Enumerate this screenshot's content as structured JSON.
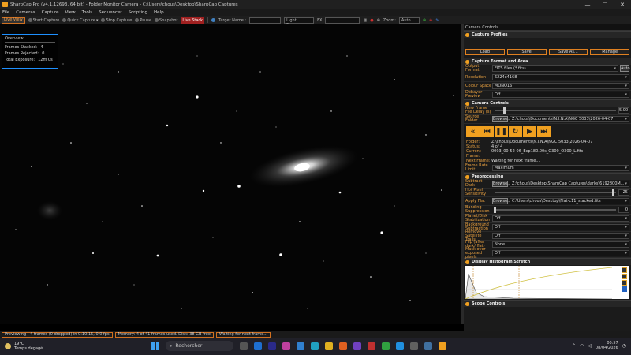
{
  "window": {
    "title": "SharpCap Pro (v4.1.12693, 64 bit) - Folder Monitor Camera - C:\\Users\\chous\\Desktop\\SharpCap Captures",
    "min": "—",
    "max": "☐",
    "close": "✕"
  },
  "menu": [
    "File",
    "Cameras",
    "Capture",
    "View",
    "Tools",
    "Sequencer",
    "Scripting",
    "Help"
  ],
  "toolbar": {
    "live_view": "Live View",
    "start_capture": "Start Capture",
    "quick_capture": "Quick Capture",
    "stop_capture": "Stop Capture",
    "pause": "Pause",
    "snapshot": "Snapshot",
    "live_stack": "Live Stack",
    "target_name_label": "Target Name :",
    "frame_type": "Light Frames",
    "fx_label": "FX",
    "zoom_label": "Zoom:",
    "zoom_value": "Auto"
  },
  "overview": {
    "title": "Overview",
    "rows": [
      {
        "label": "Frames Stacked:",
        "value": "4"
      },
      {
        "label": "Frames Rejected:",
        "value": "0"
      },
      {
        "label": "Total Exposure:",
        "value": "12m 0s"
      }
    ]
  },
  "panel": {
    "header": "Camera Controls",
    "capture_profiles": {
      "title": "Capture Profiles",
      "buttons": [
        "Load",
        "Save",
        "Save As...",
        "Manage"
      ]
    },
    "capture_format": {
      "title": "Capture Format and Area",
      "output_format_label": "Output Format",
      "output_format": "FITS files (*.fits)",
      "auto": "Auto",
      "resolution_label": "Resolution",
      "resolution": "6224x4168",
      "colour_space_label": "Colour Space",
      "colour_space": "MONO16",
      "debayer_label": "Debayer Preview",
      "debayer": "Off"
    },
    "camera_controls": {
      "title": "Camera Controls",
      "new_frame_delay_label": "New Frame File Delay (s)",
      "new_frame_delay": "5.00",
      "new_frame_delay_fraction": 0.08,
      "source_folder_label": "Source Folder",
      "browse": "Browse...",
      "source_folder": "Z:\\chous\\Documents\\N.I.N.A\\NGC 5033\\2026-04-07",
      "folder_monitor": {
        "folder_label": "Folder:",
        "folder": "Z:\\chous\\Documents\\N.I.N.A\\NGC 5033\\2026-04-07",
        "status_label": "Status:",
        "status": "4 of 4",
        "current_frame_label": "Current Frame:",
        "current_frame": "0003_00-52-06_Exp180.00s_G300_O300_L.fits",
        "next_frame_label": "Next Frame:",
        "next_frame": "Waiting for next frame..."
      },
      "frame_rate_label": "Frame Rate Limit",
      "frame_rate": "Maximum"
    },
    "preprocessing": {
      "title": "Preprocessing",
      "subtract_dark_label": "Subtract Dark",
      "browse": "Browse...",
      "subtract_dark": "Z:\\chous\\Desktop\\SharpCap Captures\\darks\\6192800M...",
      "hot_pixel_label": "Hot Pixel Sensitivity",
      "hot_pixel": "25",
      "hot_pixel_fraction": 0.98,
      "apply_flat_label": "Apply Flat",
      "apply_flat": "C:\\Users\\chous\\Desktop\\Flat-c11_stacked.fits",
      "banding_label": "Banding Suppression",
      "banding": "0",
      "banding_fraction": 0.0,
      "planet_label": "Planet/Disk Stabilization",
      "planet": "Off",
      "background_label": "Background Subtraction",
      "background": "Off",
      "satellite_label": "Remove Satellite Trails",
      "satellite": "Off",
      "flip_label": "Flip (after dark/ flat)",
      "flip": "None",
      "mask_label": "Mask over exposed pixels",
      "mask": "Off"
    },
    "histogram": {
      "title": "Display Histogram Stretch"
    },
    "scope": {
      "title": "Scope Controls"
    }
  },
  "status": {
    "previewing": "Previewing : 4 frames (0 dropped) in 0:10:15, 0.0 fps",
    "memory": "Memory: 4 of 41 frames used. Disk: 38 GB free",
    "waiting": "Waiting for next frame..."
  },
  "taskbar": {
    "temp": "19°C",
    "weather": "Temps dégagé",
    "search": "Rechercher",
    "time": "00:57",
    "date": "08/04/2026"
  }
}
